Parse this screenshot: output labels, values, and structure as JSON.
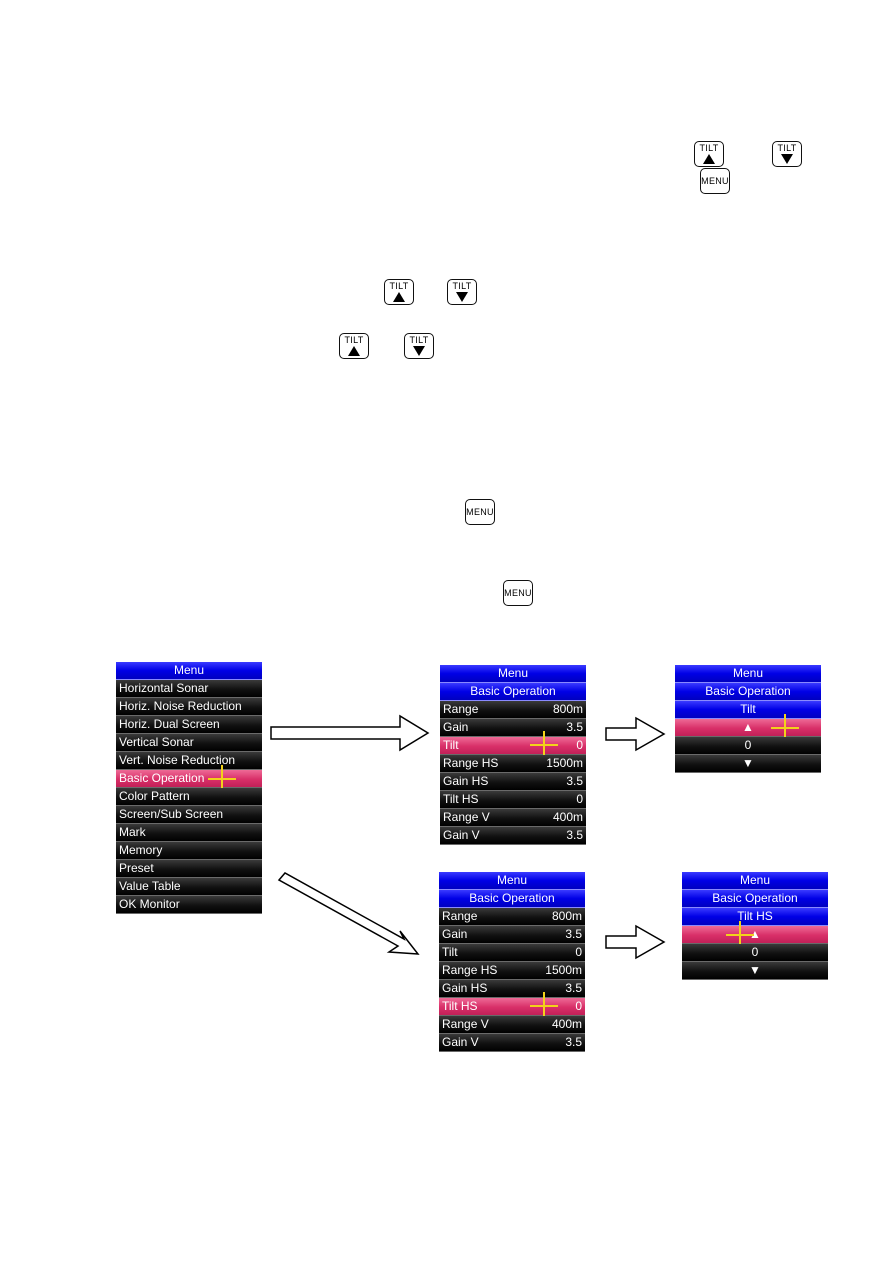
{
  "keys": {
    "tilt_label": "TILT",
    "menu_label": "MENU",
    "tilt_up_icon": "tilt-up-key-icon",
    "tilt_down_icon": "tilt-down-key-icon",
    "menu_icon": "menu-key-icon"
  },
  "main_menu": {
    "title": "Menu",
    "items": [
      {
        "label": "Horizontal Sonar"
      },
      {
        "label": "Horiz. Noise Reduction"
      },
      {
        "label": "Horiz. Dual Screen"
      },
      {
        "label": "Vertical Sonar"
      },
      {
        "label": "Vert. Noise Reduction"
      },
      {
        "label": "Basic Operation",
        "selected": true
      },
      {
        "label": "Color Pattern"
      },
      {
        "label": "Screen/Sub Screen"
      },
      {
        "label": "Mark"
      },
      {
        "label": "Memory"
      },
      {
        "label": "Preset"
      },
      {
        "label": "Value Table"
      },
      {
        "label": "OK Monitor"
      }
    ]
  },
  "basic_menu_a": {
    "title": "Menu",
    "subtitle": "Basic Operation",
    "selected": "Tilt",
    "items": [
      {
        "label": "Range",
        "value": "800m"
      },
      {
        "label": "Gain",
        "value": "3.5"
      },
      {
        "label": "Tilt",
        "value": "0"
      },
      {
        "label": "Range HS",
        "value": "1500m"
      },
      {
        "label": "Gain HS",
        "value": "3.5"
      },
      {
        "label": "Tilt HS",
        "value": "0"
      },
      {
        "label": "Range V",
        "value": "400m"
      },
      {
        "label": "Gain V",
        "value": "3.5"
      }
    ]
  },
  "basic_menu_b": {
    "title": "Menu",
    "subtitle": "Basic Operation",
    "selected": "Tilt HS",
    "items": [
      {
        "label": "Range",
        "value": "800m"
      },
      {
        "label": "Gain",
        "value": "3.5"
      },
      {
        "label": "Tilt",
        "value": "0"
      },
      {
        "label": "Range HS",
        "value": "1500m"
      },
      {
        "label": "Gain HS",
        "value": "3.5"
      },
      {
        "label": "Tilt HS",
        "value": "0"
      },
      {
        "label": "Range V",
        "value": "400m"
      },
      {
        "label": "Gain V",
        "value": "3.5"
      }
    ]
  },
  "tilt_editor_a": {
    "title": "Menu",
    "subtitle": "Basic Operation",
    "setting": "Tilt",
    "up": "▲",
    "value": "0",
    "down": "▼"
  },
  "tilt_editor_b": {
    "title": "Menu",
    "subtitle": "Basic Operation",
    "setting": "Tilt HS",
    "up": "▲",
    "value": "0",
    "down": "▼"
  },
  "colors": {
    "header_blue": "#0000e6",
    "row_black": "#111111",
    "selected_pink": "#d82f68",
    "cursor_yellow": "#f2d21b"
  }
}
